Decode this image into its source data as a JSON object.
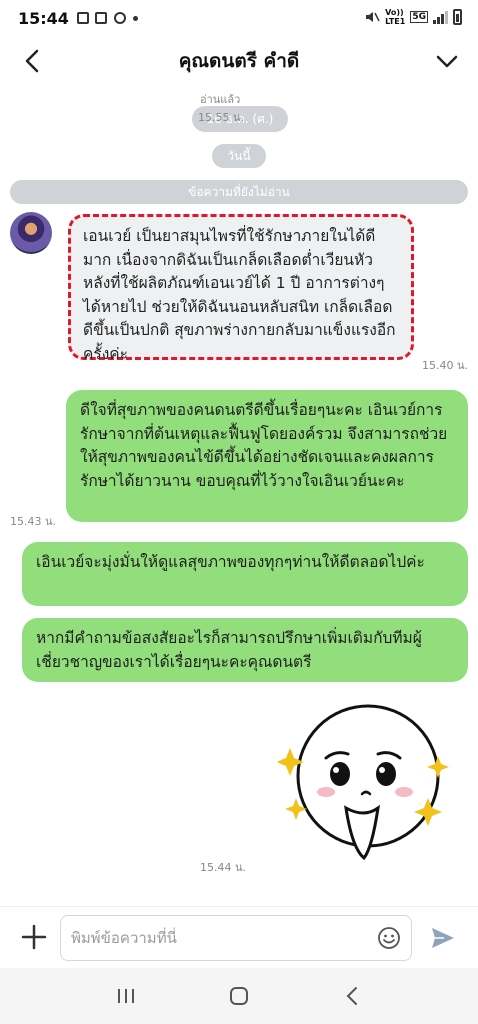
{
  "status_bar": {
    "time": "15:44",
    "network_label_1": "Vo))",
    "network_label_2": "LTE1",
    "network_type": "5G"
  },
  "header": {
    "title": "คุณดนตรี คำดี",
    "back_icon": "chevron-left-icon",
    "menu_icon": "chevron-down-icon"
  },
  "chat": {
    "read_label": "อ่านแล้ว",
    "prev_time": "15.55 น.",
    "prev_date_pill": "16 ธ.ค. (ศ.)",
    "today_pill": "วันนี้",
    "unread_divider": "ข้อความที่ยังไม่อ่าน",
    "messages": [
      {
        "direction": "in",
        "text": "เอนเวย์ เป็นยาสมุนไพรที่ใช้รักษาภายในได้ดีมาก เนื่องจากดิฉันเป็นเกล็ดเลือดต่ำเวียนหัว หลังที่ใช้ผลิตภัณฑ์เอนเวย์ได้ 1 ปี อาการต่างๆได้หายไป ช่วยให้ดิฉันนอนหลับสนิท เกล็ดเลือดดีขึ้นเป็นปกติ สุขภาพร่างกายกลับมาแข็งแรงอีกครั้งค่ะ",
        "time": "15.40 น."
      },
      {
        "direction": "out",
        "text": "ดีใจที่สุขภาพของคนดนตรีดีขึ้นเรื่อยๆนะคะ เอินเวย์การรักษาจากที่ต้นเหตุและฟื้นฟูโดยองค์รวม จึงสามารถช่วยให้สุขภาพของคนไข้ดีขึ้นได้อย่างชัดเจนและคงผลการรักษาได้ยาวนาน ขอบคุณที่ไว้วางใจเอินเวย์นะคะ",
        "time": "15.43 น."
      },
      {
        "direction": "out",
        "text": "เอินเวย์จะมุ่งมั่นให้ดูแลสุขภาพของทุกๆท่านให้ดีตลอดไปค่ะ",
        "time": ""
      },
      {
        "direction": "out",
        "text": "หากมีคำถามข้อสงสัยอะไรก็สามารถปรึกษาเพิ่มเติมกับทีมผู้เชี่ยวชาญของเราได้เรื่อยๆนะคะคุณดนตรี",
        "time": ""
      }
    ],
    "sticker_time": "15.44 น."
  },
  "input_bar": {
    "placeholder": "พิมพ์ข้อความที่นี่",
    "plus_icon": "plus-icon",
    "emoji_icon": "emoji-icon",
    "send_icon": "send-icon"
  },
  "nav_bar": {
    "recent_icon": "recent-apps-icon",
    "home_icon": "home-icon",
    "back_icon": "nav-back-icon"
  },
  "colors": {
    "outgoing_bubble": "#92de7c",
    "incoming_bubble": "#eef0f2",
    "highlight_border": "#e0182b",
    "pill_gray": "#cfd3d8",
    "send_blue": "#8fa3bd"
  }
}
